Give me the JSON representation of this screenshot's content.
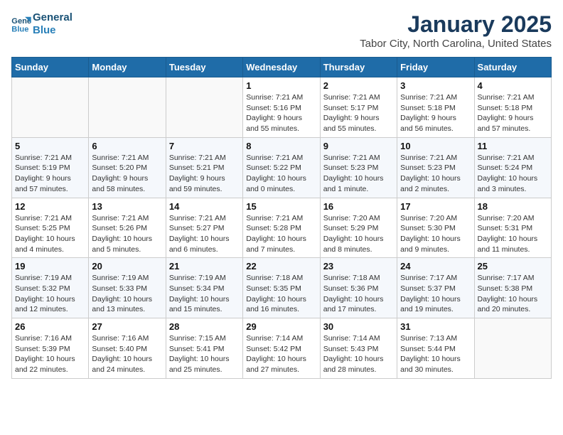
{
  "header": {
    "logo_line1": "General",
    "logo_line2": "Blue",
    "title": "January 2025",
    "subtitle": "Tabor City, North Carolina, United States"
  },
  "weekdays": [
    "Sunday",
    "Monday",
    "Tuesday",
    "Wednesday",
    "Thursday",
    "Friday",
    "Saturday"
  ],
  "weeks": [
    [
      {
        "day": "",
        "info": ""
      },
      {
        "day": "",
        "info": ""
      },
      {
        "day": "",
        "info": ""
      },
      {
        "day": "1",
        "info": "Sunrise: 7:21 AM\nSunset: 5:16 PM\nDaylight: 9 hours\nand 55 minutes."
      },
      {
        "day": "2",
        "info": "Sunrise: 7:21 AM\nSunset: 5:17 PM\nDaylight: 9 hours\nand 55 minutes."
      },
      {
        "day": "3",
        "info": "Sunrise: 7:21 AM\nSunset: 5:18 PM\nDaylight: 9 hours\nand 56 minutes."
      },
      {
        "day": "4",
        "info": "Sunrise: 7:21 AM\nSunset: 5:18 PM\nDaylight: 9 hours\nand 57 minutes."
      }
    ],
    [
      {
        "day": "5",
        "info": "Sunrise: 7:21 AM\nSunset: 5:19 PM\nDaylight: 9 hours\nand 57 minutes."
      },
      {
        "day": "6",
        "info": "Sunrise: 7:21 AM\nSunset: 5:20 PM\nDaylight: 9 hours\nand 58 minutes."
      },
      {
        "day": "7",
        "info": "Sunrise: 7:21 AM\nSunset: 5:21 PM\nDaylight: 9 hours\nand 59 minutes."
      },
      {
        "day": "8",
        "info": "Sunrise: 7:21 AM\nSunset: 5:22 PM\nDaylight: 10 hours\nand 0 minutes."
      },
      {
        "day": "9",
        "info": "Sunrise: 7:21 AM\nSunset: 5:23 PM\nDaylight: 10 hours\nand 1 minute."
      },
      {
        "day": "10",
        "info": "Sunrise: 7:21 AM\nSunset: 5:23 PM\nDaylight: 10 hours\nand 2 minutes."
      },
      {
        "day": "11",
        "info": "Sunrise: 7:21 AM\nSunset: 5:24 PM\nDaylight: 10 hours\nand 3 minutes."
      }
    ],
    [
      {
        "day": "12",
        "info": "Sunrise: 7:21 AM\nSunset: 5:25 PM\nDaylight: 10 hours\nand 4 minutes."
      },
      {
        "day": "13",
        "info": "Sunrise: 7:21 AM\nSunset: 5:26 PM\nDaylight: 10 hours\nand 5 minutes."
      },
      {
        "day": "14",
        "info": "Sunrise: 7:21 AM\nSunset: 5:27 PM\nDaylight: 10 hours\nand 6 minutes."
      },
      {
        "day": "15",
        "info": "Sunrise: 7:21 AM\nSunset: 5:28 PM\nDaylight: 10 hours\nand 7 minutes."
      },
      {
        "day": "16",
        "info": "Sunrise: 7:20 AM\nSunset: 5:29 PM\nDaylight: 10 hours\nand 8 minutes."
      },
      {
        "day": "17",
        "info": "Sunrise: 7:20 AM\nSunset: 5:30 PM\nDaylight: 10 hours\nand 9 minutes."
      },
      {
        "day": "18",
        "info": "Sunrise: 7:20 AM\nSunset: 5:31 PM\nDaylight: 10 hours\nand 11 minutes."
      }
    ],
    [
      {
        "day": "19",
        "info": "Sunrise: 7:19 AM\nSunset: 5:32 PM\nDaylight: 10 hours\nand 12 minutes."
      },
      {
        "day": "20",
        "info": "Sunrise: 7:19 AM\nSunset: 5:33 PM\nDaylight: 10 hours\nand 13 minutes."
      },
      {
        "day": "21",
        "info": "Sunrise: 7:19 AM\nSunset: 5:34 PM\nDaylight: 10 hours\nand 15 minutes."
      },
      {
        "day": "22",
        "info": "Sunrise: 7:18 AM\nSunset: 5:35 PM\nDaylight: 10 hours\nand 16 minutes."
      },
      {
        "day": "23",
        "info": "Sunrise: 7:18 AM\nSunset: 5:36 PM\nDaylight: 10 hours\nand 17 minutes."
      },
      {
        "day": "24",
        "info": "Sunrise: 7:17 AM\nSunset: 5:37 PM\nDaylight: 10 hours\nand 19 minutes."
      },
      {
        "day": "25",
        "info": "Sunrise: 7:17 AM\nSunset: 5:38 PM\nDaylight: 10 hours\nand 20 minutes."
      }
    ],
    [
      {
        "day": "26",
        "info": "Sunrise: 7:16 AM\nSunset: 5:39 PM\nDaylight: 10 hours\nand 22 minutes."
      },
      {
        "day": "27",
        "info": "Sunrise: 7:16 AM\nSunset: 5:40 PM\nDaylight: 10 hours\nand 24 minutes."
      },
      {
        "day": "28",
        "info": "Sunrise: 7:15 AM\nSunset: 5:41 PM\nDaylight: 10 hours\nand 25 minutes."
      },
      {
        "day": "29",
        "info": "Sunrise: 7:14 AM\nSunset: 5:42 PM\nDaylight: 10 hours\nand 27 minutes."
      },
      {
        "day": "30",
        "info": "Sunrise: 7:14 AM\nSunset: 5:43 PM\nDaylight: 10 hours\nand 28 minutes."
      },
      {
        "day": "31",
        "info": "Sunrise: 7:13 AM\nSunset: 5:44 PM\nDaylight: 10 hours\nand 30 minutes."
      },
      {
        "day": "",
        "info": ""
      }
    ]
  ]
}
